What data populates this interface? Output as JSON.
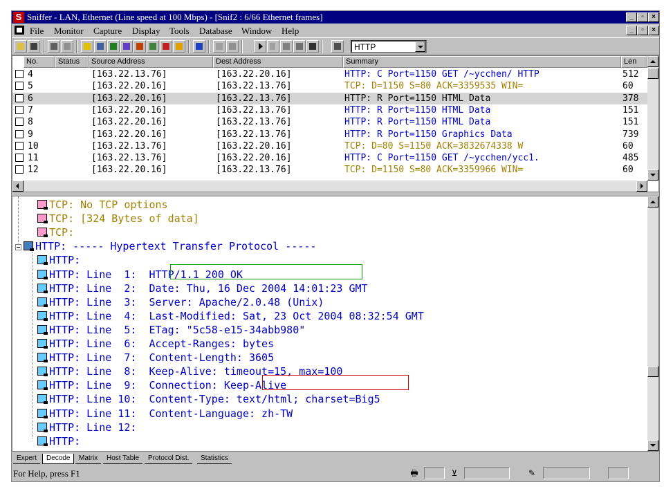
{
  "window": {
    "title": "Sniffer - LAN, Ethernet (Line speed at 100 Mbps) - [Snif2 : 6/66 Ethernet frames]",
    "app_icon_letter": "S",
    "controls": [
      "_",
      "▫",
      "×"
    ],
    "doc_controls": [
      "_",
      "▫",
      "×"
    ]
  },
  "menu": [
    "File",
    "Monitor",
    "Capture",
    "Display",
    "Tools",
    "Database",
    "Window",
    "Help"
  ],
  "toolbar": {
    "filter_value": "HTTP"
  },
  "packet_list": {
    "columns": [
      "No.",
      "Status",
      "Source Address",
      "Dest Address",
      "Summary",
      "Len"
    ],
    "rows": [
      {
        "no": "4",
        "src": "[163.22.13.76]",
        "dst": "[163.22.20.16]",
        "summary": "HTTP: C Port=1150 GET /~ycchen/ HTTP",
        "len": "512",
        "color": "#0000c0"
      },
      {
        "no": "5",
        "src": "[163.22.20.16]",
        "dst": "[163.22.13.76]",
        "summary": "TCP: D=1150 S=80     ACK=3359535 WIN=",
        "len": "60",
        "color": "#a08000"
      },
      {
        "no": "6",
        "src": "[163.22.20.16]",
        "dst": "[163.22.13.76]",
        "summary": "HTTP: R Port=1150 HTML Data",
        "len": "378",
        "color": "#000000",
        "selected": true
      },
      {
        "no": "7",
        "src": "[163.22.20.16]",
        "dst": "[163.22.13.76]",
        "summary": "HTTP: R Port=1150 HTML Data",
        "len": "151",
        "color": "#0000c0"
      },
      {
        "no": "8",
        "src": "[163.22.20.16]",
        "dst": "[163.22.13.76]",
        "summary": "HTTP: R Port=1150 HTML Data",
        "len": "151",
        "color": "#0000c0"
      },
      {
        "no": "9",
        "src": "[163.22.20.16]",
        "dst": "[163.22.13.76]",
        "summary": "HTTP: R Port=1150 Graphics Data",
        "len": "739",
        "color": "#0000c0"
      },
      {
        "no": "10",
        "src": "[163.22.13.76]",
        "dst": "[163.22.20.16]",
        "summary": "TCP: D=80 S=1150      ACK=3832674338 W",
        "len": "60",
        "color": "#a08000"
      },
      {
        "no": "11",
        "src": "[163.22.13.76]",
        "dst": "[163.22.20.16]",
        "summary": "HTTP: C Port=1150 GET /~ycchen/ycc1.",
        "len": "485",
        "color": "#0000c0"
      },
      {
        "no": "12",
        "src": "[163.22.20.16]",
        "dst": "[163.22.13.76]",
        "summary": "TCP: D=1150 S=80     ACK=3359966 WIN=",
        "len": "60",
        "color": "#a08000"
      }
    ]
  },
  "decode": {
    "lines": [
      {
        "icon": "tcp",
        "text": "TCP: No TCP options",
        "color": "#a08000",
        "indent": 1
      },
      {
        "icon": "tcp",
        "text": "TCP: [324 Bytes of data]",
        "color": "#a08000",
        "indent": 1
      },
      {
        "icon": "tcp",
        "text": "TCP:",
        "color": "#a08000",
        "indent": 1
      },
      {
        "icon": "proto",
        "text": "HTTP: ----- Hypertext Transfer Protocol -----",
        "color": "#0000c0",
        "indent": 0
      },
      {
        "icon": "http",
        "text": "HTTP:",
        "color": "#0000c0",
        "indent": 1
      },
      {
        "icon": "http",
        "text": "HTTP: Line  1:  HTTP/1.1 200 OK",
        "color": "#0000c0",
        "indent": 1
      },
      {
        "icon": "http",
        "text": "HTTP: Line  2:  Date: Thu, 16 Dec 2004 14:01:23 GMT",
        "color": "#0000c0",
        "indent": 1
      },
      {
        "icon": "http",
        "text": "HTTP: Line  3:  Server: Apache/2.0.48 (Unix)",
        "color": "#0000c0",
        "indent": 1
      },
      {
        "icon": "http",
        "text": "HTTP: Line  4:  Last-Modified: Sat, 23 Oct 2004 08:32:54 GMT",
        "color": "#0000c0",
        "indent": 1
      },
      {
        "icon": "http",
        "text": "HTTP: Line  5:  ETag: \"5c58-e15-34abb980\"",
        "color": "#0000c0",
        "indent": 1
      },
      {
        "icon": "http",
        "text": "HTTP: Line  6:  Accept-Ranges: bytes",
        "color": "#0000c0",
        "indent": 1
      },
      {
        "icon": "http",
        "text": "HTTP: Line  7:  Content-Length: 3605",
        "color": "#0000c0",
        "indent": 1
      },
      {
        "icon": "http",
        "text": "HTTP: Line  8:  Keep-Alive: timeout=15, max=100",
        "color": "#0000c0",
        "indent": 1
      },
      {
        "icon": "http",
        "text": "HTTP: Line  9:  Connection: Keep-Alive",
        "color": "#0000c0",
        "indent": 1
      },
      {
        "icon": "http",
        "text": "HTTP: Line 10:  Content-Type: text/html; charset=Big5",
        "color": "#0000c0",
        "indent": 1
      },
      {
        "icon": "http",
        "text": "HTTP: Line 11:  Content-Language: zh-TW",
        "color": "#0000c0",
        "indent": 1
      },
      {
        "icon": "http",
        "text": "HTTP: Line 12:",
        "color": "#0000c0",
        "indent": 1
      },
      {
        "icon": "http",
        "text": "HTTP:",
        "color": "#0000c0",
        "indent": 1
      }
    ]
  },
  "tabs": [
    "Expert",
    "Decode",
    "Matrix",
    "Host Table",
    "Protocol Dist.",
    "Statistics"
  ],
  "active_tab": "Decode",
  "status": {
    "help": "For Help, press F1"
  }
}
